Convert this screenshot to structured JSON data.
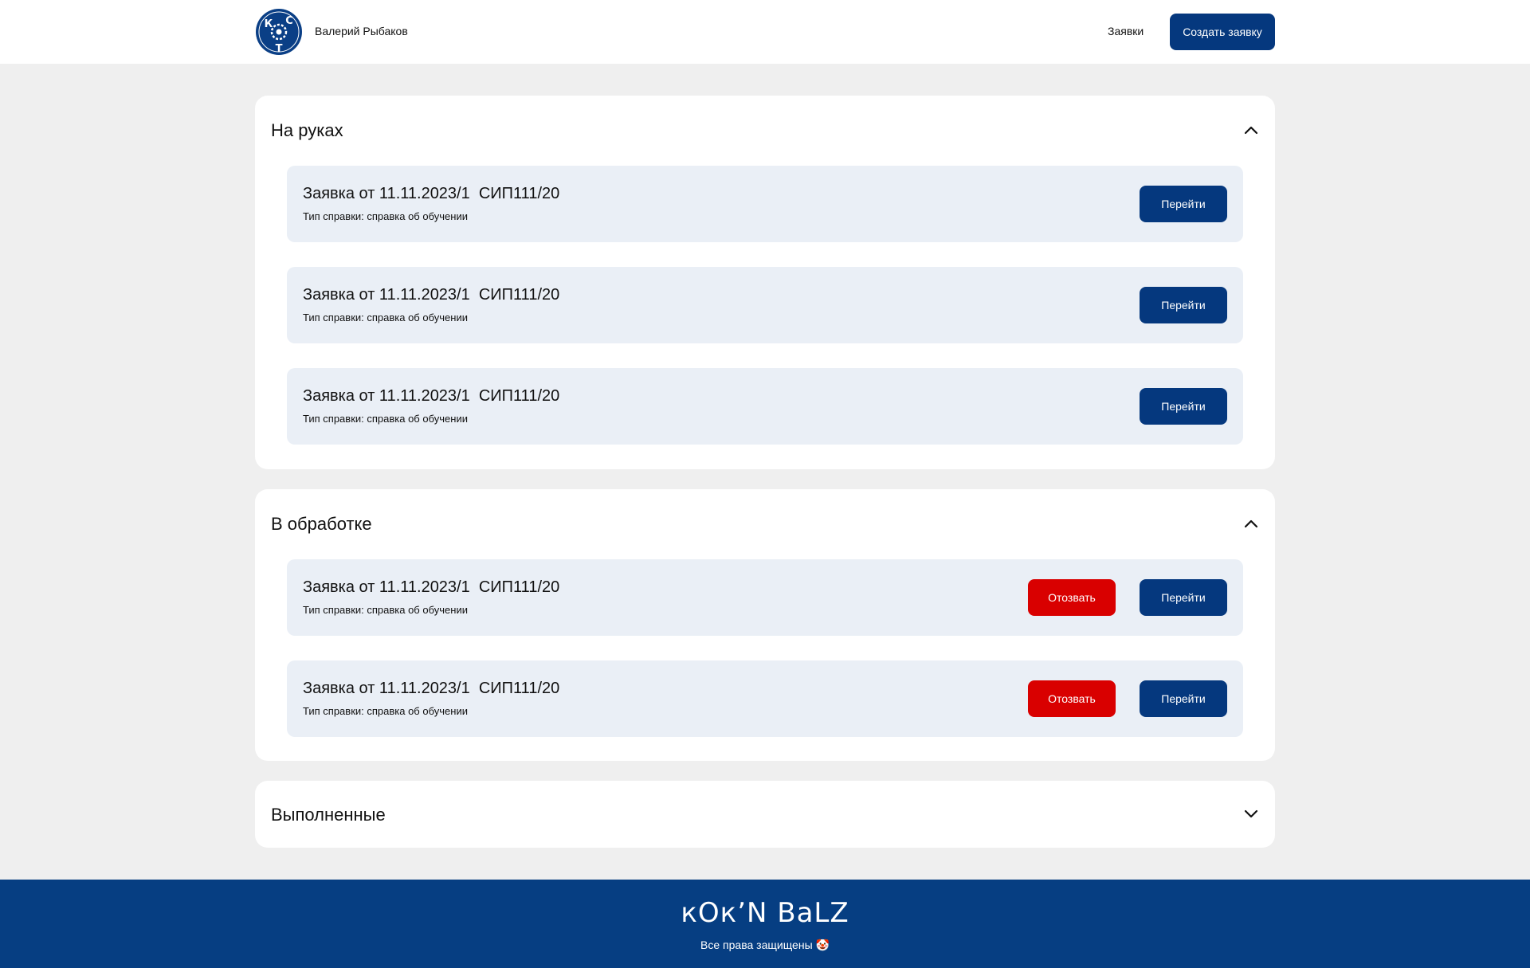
{
  "header": {
    "user_name": "Валерий Рыбаков",
    "nav_requests": "Заявки",
    "create_button": "Создать заявку",
    "logo_letters": [
      "К",
      "С",
      "Т"
    ]
  },
  "sections": [
    {
      "title": "На руках",
      "expanded": true,
      "items": [
        {
          "title": "Заявка от 11.11.2023/1  СИП111/20",
          "subtitle": "Тип справки: справка об обучении",
          "go_label": "Перейти"
        },
        {
          "title": "Заявка от 11.11.2023/1  СИП111/20",
          "subtitle": "Тип справки: справка об обучении",
          "go_label": "Перейти"
        },
        {
          "title": "Заявка от 11.11.2023/1  СИП111/20",
          "subtitle": "Тип справки: справка об обучении",
          "go_label": "Перейти"
        }
      ]
    },
    {
      "title": "В обработке",
      "expanded": true,
      "items": [
        {
          "title": "Заявка от 11.11.2023/1  СИП111/20",
          "subtitle": "Тип справки: справка об обучении",
          "revoke_label": "Отозвать",
          "go_label": "Перейти"
        },
        {
          "title": "Заявка от 11.11.2023/1  СИП111/20",
          "subtitle": "Тип справки: справка об обучении",
          "revoke_label": "Отозвать",
          "go_label": "Перейти"
        }
      ]
    },
    {
      "title": "Выполненные",
      "expanded": false,
      "items": []
    }
  ],
  "footer": {
    "brand": "кОк’N BаLZ",
    "rights": "Все права защищены 🤡"
  },
  "colors": {
    "primary": "#05387e",
    "danger": "#d90000",
    "card_bg": "#eaeff6",
    "page_bg": "#efefef",
    "footer_bg": "#063e82"
  }
}
